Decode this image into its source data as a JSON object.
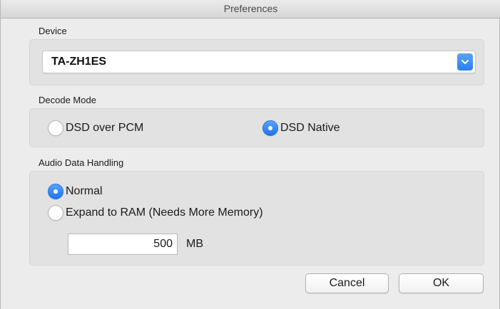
{
  "window": {
    "title": "Preferences"
  },
  "device": {
    "label": "Device",
    "selected": "TA-ZH1ES"
  },
  "decode_mode": {
    "label": "Decode Mode",
    "options": [
      {
        "label": "DSD over PCM",
        "selected": false
      },
      {
        "label": "DSD Native",
        "selected": true
      }
    ]
  },
  "audio_data_handling": {
    "label": "Audio Data Handling",
    "options": [
      {
        "label": "Normal",
        "selected": true
      },
      {
        "label": "Expand to RAM (Needs More Memory)",
        "selected": false
      }
    ],
    "memory_value": "500",
    "memory_unit": "MB"
  },
  "buttons": {
    "cancel": "Cancel",
    "ok": "OK"
  },
  "icons": {
    "dropdown": "chevron-down-icon"
  },
  "colors": {
    "accent": "#2b7ff0"
  }
}
